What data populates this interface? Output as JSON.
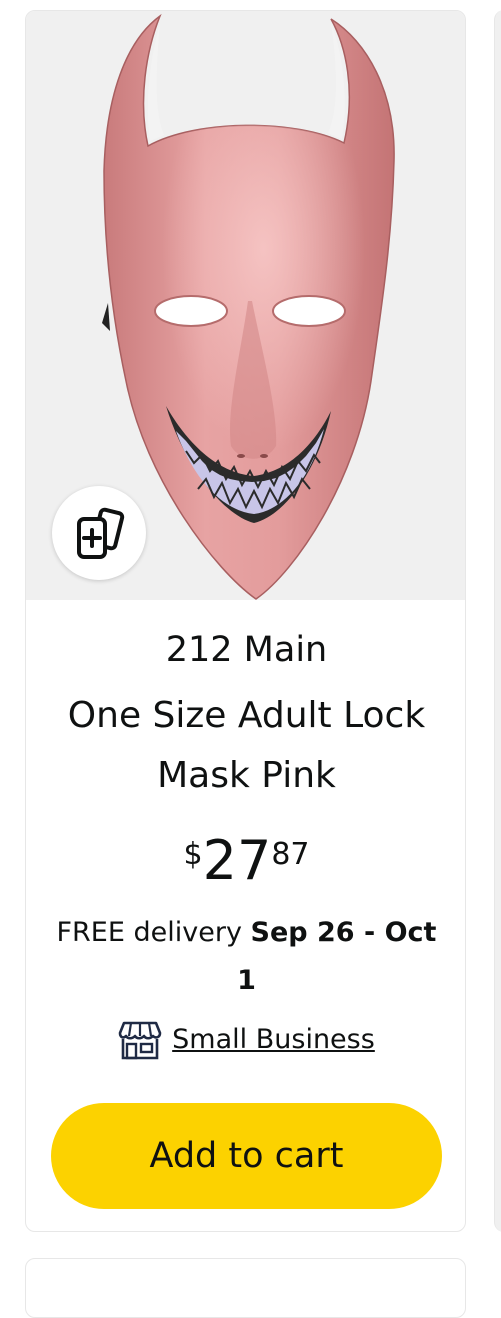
{
  "product": {
    "image_alt": "Pink Lock mask",
    "brand": "212 Main",
    "title": "One Size Adult Lock Mask Pink",
    "price": {
      "symbol": "$",
      "whole": "27",
      "fraction": "87"
    },
    "delivery": {
      "prefix": "FREE delivery",
      "date": "Sep 26 - Oct 1"
    },
    "badge": {
      "icon": "storefront-icon",
      "label": "Small Business"
    },
    "add_to_cart_label": "Add to cart",
    "compare_icon": "compare-cards-icon"
  },
  "colors": {
    "accent_button": "#fcd200",
    "image_background": "#f0f0f0",
    "mask_pink": "#dc8f8f"
  }
}
